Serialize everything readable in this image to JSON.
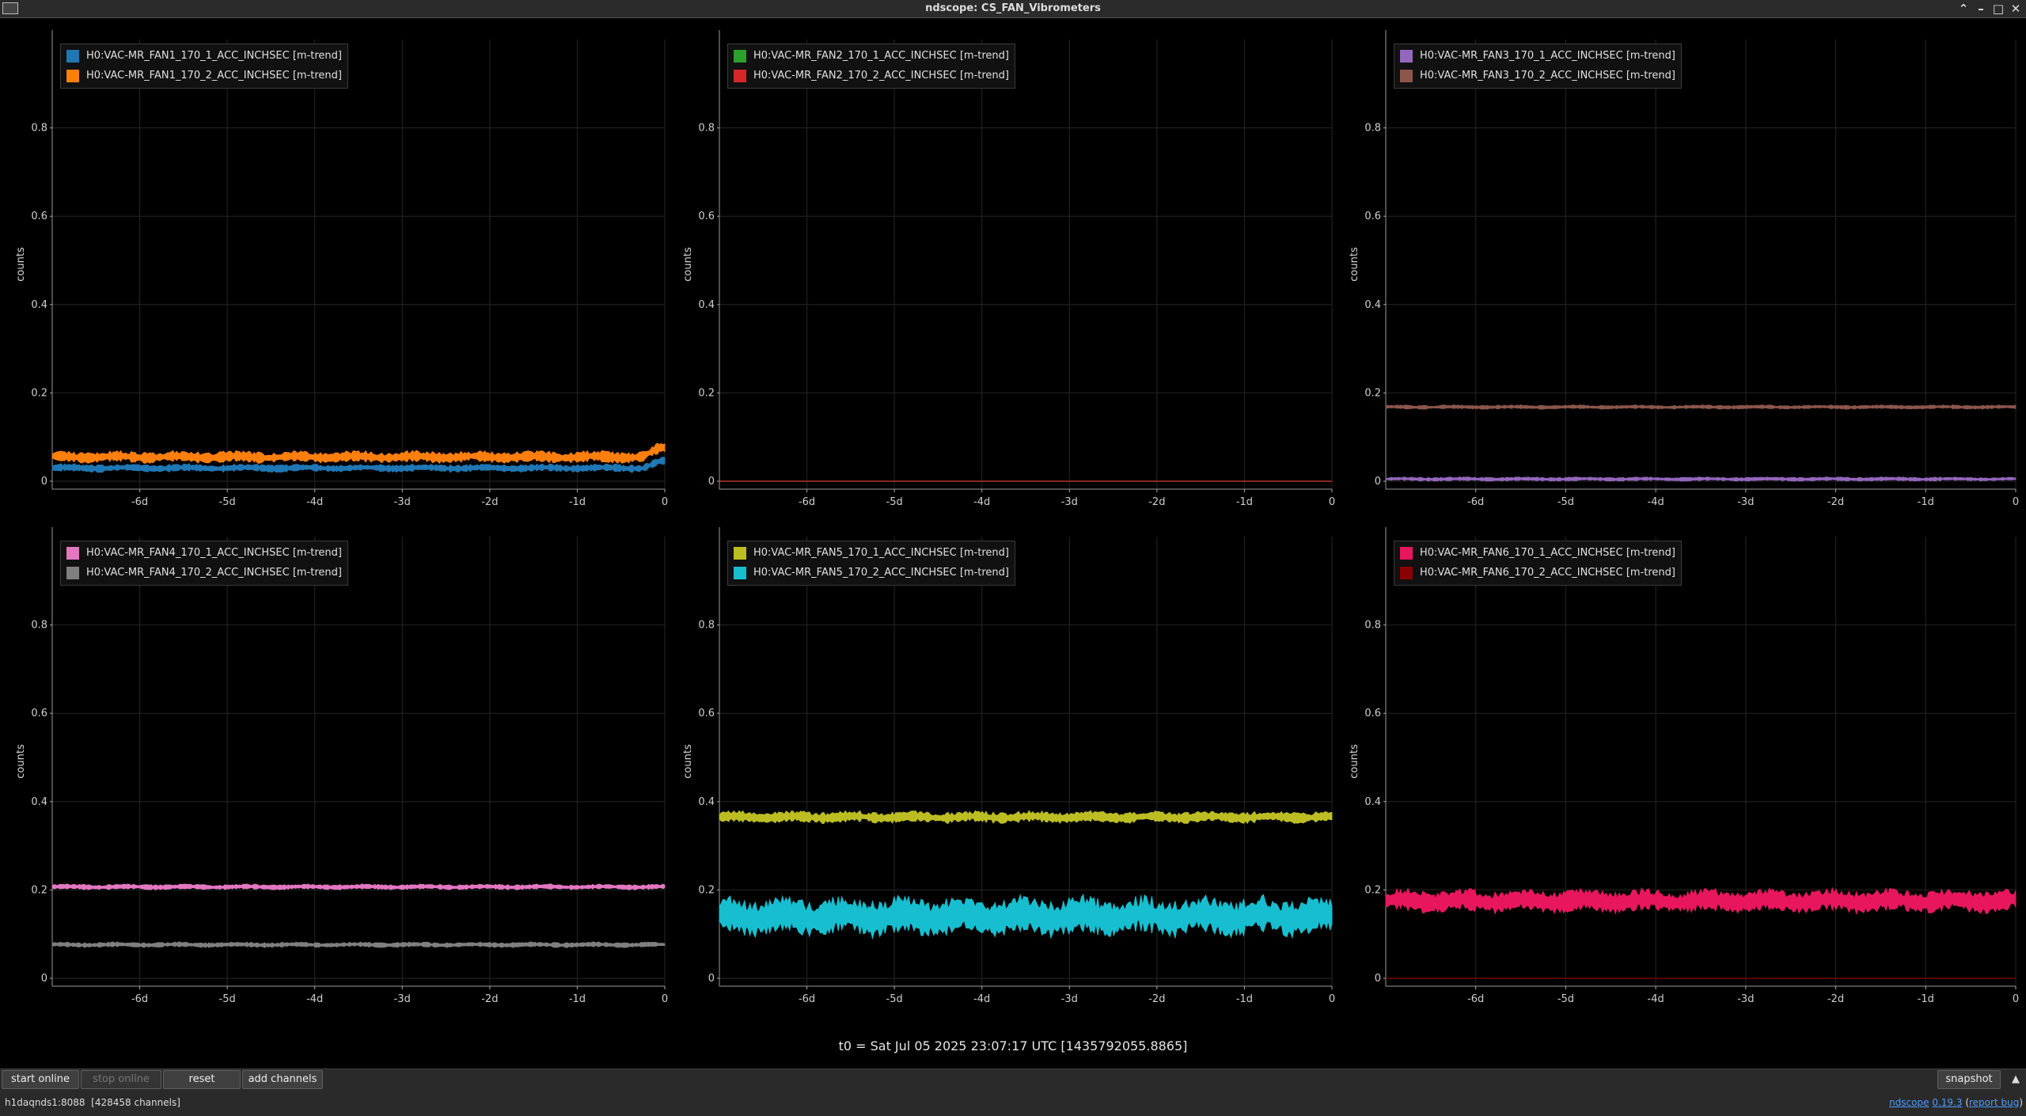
{
  "window": {
    "title": "ndscope: CS_FAN_Vibrometers",
    "controls": [
      "chevron-up",
      "minimize",
      "maximize",
      "close"
    ]
  },
  "axes": {
    "ylabel": "counts",
    "yticks": [
      "0",
      "0.2",
      "0.4",
      "0.6",
      "0.8"
    ],
    "xticks": [
      "-6d",
      "-5d",
      "-4d",
      "-3d",
      "-2d",
      "-1d",
      "0"
    ]
  },
  "chart_data": [
    {
      "type": "line",
      "ylabel": "counts",
      "ylim": [
        0,
        1
      ],
      "x_ticks": [
        "-6d",
        "-5d",
        "-4d",
        "-3d",
        "-2d",
        "-1d",
        "0"
      ],
      "legend": "top-left",
      "grid": true,
      "series": [
        {
          "name": "H0:VAC-MR_FAN1_170_1_ACC_INCHSEC [m-trend]",
          "color": "#1f77b4",
          "level": 0.03,
          "band": 0.006,
          "endLevel": 0.045
        },
        {
          "name": "H0:VAC-MR_FAN1_170_2_ACC_INCHSEC [m-trend]",
          "color": "#ff7f0e",
          "level": 0.055,
          "band": 0.009,
          "endLevel": 0.075
        }
      ]
    },
    {
      "type": "line",
      "ylabel": "counts",
      "ylim": [
        0,
        1
      ],
      "x_ticks": [
        "-6d",
        "-5d",
        "-4d",
        "-3d",
        "-2d",
        "-1d",
        "0"
      ],
      "legend": "top-left",
      "grid": true,
      "series": [
        {
          "name": "H0:VAC-MR_FAN2_170_1_ACC_INCHSEC [m-trend]",
          "color": "#2ca02c",
          "level": 0.0,
          "band": 0.0
        },
        {
          "name": "H0:VAC-MR_FAN2_170_2_ACC_INCHSEC [m-trend]",
          "color": "#d62728",
          "level": 0.0,
          "band": 0.0
        }
      ]
    },
    {
      "type": "line",
      "ylabel": "counts",
      "ylim": [
        0,
        1
      ],
      "x_ticks": [
        "-6d",
        "-5d",
        "-4d",
        "-3d",
        "-2d",
        "-1d",
        "0"
      ],
      "legend": "top-left",
      "grid": true,
      "series": [
        {
          "name": "H0:VAC-MR_FAN3_170_1_ACC_INCHSEC [m-trend]",
          "color": "#9467bd",
          "level": 0.005,
          "band": 0.003
        },
        {
          "name": "H0:VAC-MR_FAN3_170_2_ACC_INCHSEC [m-trend]",
          "color": "#8c564b",
          "level": 0.168,
          "band": 0.003
        }
      ]
    },
    {
      "type": "line",
      "ylabel": "counts",
      "ylim": [
        0,
        1
      ],
      "x_ticks": [
        "-6d",
        "-5d",
        "-4d",
        "-3d",
        "-2d",
        "-1d",
        "0"
      ],
      "legend": "top-left",
      "grid": true,
      "series": [
        {
          "name": "H0:VAC-MR_FAN4_170_1_ACC_INCHSEC [m-trend]",
          "color": "#e377c2",
          "level": 0.207,
          "band": 0.004
        },
        {
          "name": "H0:VAC-MR_FAN4_170_2_ACC_INCHSEC [m-trend]",
          "color": "#7f7f7f",
          "level": 0.076,
          "band": 0.004
        }
      ]
    },
    {
      "type": "line",
      "ylabel": "counts",
      "ylim": [
        0,
        1
      ],
      "x_ticks": [
        "-6d",
        "-5d",
        "-4d",
        "-3d",
        "-2d",
        "-1d",
        "0"
      ],
      "legend": "top-left",
      "grid": true,
      "series": [
        {
          "name": "H0:VAC-MR_FAN5_170_1_ACC_INCHSEC [m-trend]",
          "color": "#bcbd22",
          "level": 0.365,
          "band": 0.009
        },
        {
          "name": "H0:VAC-MR_FAN5_170_2_ACC_INCHSEC [m-trend]",
          "color": "#17becf",
          "level": 0.14,
          "band": 0.03
        }
      ]
    },
    {
      "type": "line",
      "ylabel": "counts",
      "ylim": [
        0,
        1
      ],
      "x_ticks": [
        "-6d",
        "-5d",
        "-4d",
        "-3d",
        "-2d",
        "-1d",
        "0"
      ],
      "legend": "top-left",
      "grid": true,
      "series": [
        {
          "name": "H0:VAC-MR_FAN6_170_1_ACC_INCHSEC [m-trend]",
          "color": "#e8175d",
          "level": 0.175,
          "band": 0.018
        },
        {
          "name": "H0:VAC-MR_FAN6_170_2_ACC_INCHSEC [m-trend]",
          "color": "#8b0000",
          "level": 0.0,
          "band": 0.0
        }
      ]
    }
  ],
  "t0_label": "t0 = Sat Jul 05 2025 23:07:17 UTC [1435792055.8865]",
  "toolbar": {
    "start_online": "start online",
    "stop_online": "stop online",
    "reset": "reset",
    "add_channels": "add channels",
    "snapshot": "snapshot"
  },
  "status": {
    "server": "h1daqnds1:8088",
    "channels": "[428458 channels]",
    "app_name": "ndscope",
    "version": "0.19.3",
    "report_bug": "report bug"
  }
}
